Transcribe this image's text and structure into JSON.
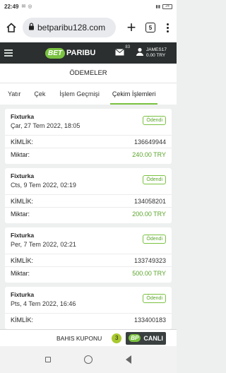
{
  "status_bar": {
    "time": "22:49",
    "battery": "24"
  },
  "browser": {
    "url": "betparibu128.com",
    "tab_count": "5"
  },
  "header": {
    "logo_bet": "BET",
    "logo_name": "PARIBU",
    "message_count": "83",
    "username": "JAMES17",
    "balance": "0.00 TRY"
  },
  "page": {
    "title": "ÖDEMELER"
  },
  "tabs": [
    {
      "label": "Yatır"
    },
    {
      "label": "Çek"
    },
    {
      "label": "İşlem Geçmişi"
    },
    {
      "label": "Çekim İşlemleri"
    }
  ],
  "labels": {
    "kimlik": "KİMLİK:",
    "miktar": "Miktar:"
  },
  "transactions": [
    {
      "method": "Fixturka",
      "date": "Çar, 27 Tem 2022, 18:05",
      "status": "Ödendi",
      "kimlik": "136649944",
      "miktar": "240.00 TRY"
    },
    {
      "method": "Fixturka",
      "date": "Cts, 9 Tem 2022, 02:19",
      "status": "Ödendi",
      "kimlik": "134058201",
      "miktar": "200.00 TRY"
    },
    {
      "method": "Fixturka",
      "date": "Per, 7 Tem 2022, 02:21",
      "status": "Ödendi",
      "kimlik": "133749323",
      "miktar": "500.00 TRY"
    },
    {
      "method": "Fixturka",
      "date": "Pts, 4 Tem 2022, 16:46",
      "status": "Ödendi",
      "kimlik": "133400183",
      "miktar": ""
    }
  ],
  "coupon": {
    "label": "BAHIS KUPONU",
    "count": "3",
    "live_badge": "BP",
    "live_label": "CANLI"
  },
  "icons": [
    "home-icon",
    "lock-icon",
    "plus-icon",
    "menu-icon",
    "envelope-icon",
    "user-icon",
    "back-icon",
    "circle-home-icon",
    "recents-icon"
  ],
  "colors": {
    "accent": "#7ac241",
    "header_bg": "#2b2f2f",
    "paid_green": "#5aa52a"
  }
}
